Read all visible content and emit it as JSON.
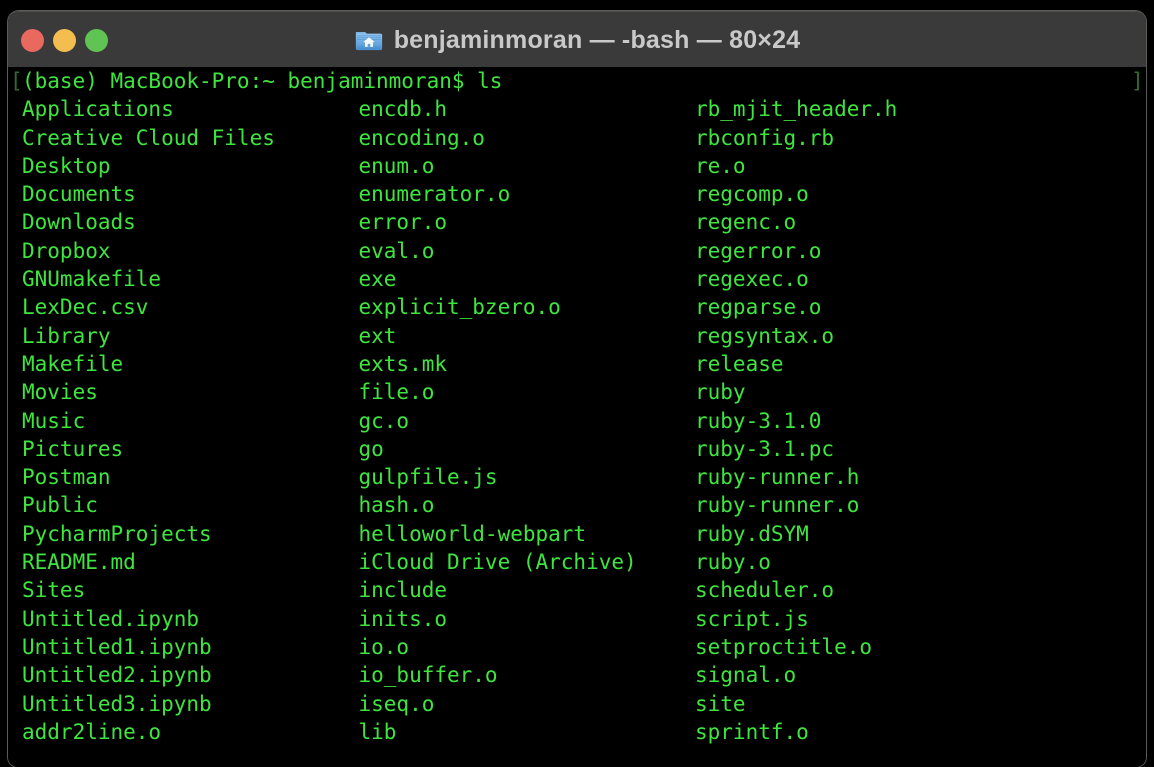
{
  "window": {
    "title": "benjaminmoran — -bash — 80×24",
    "icon": "home-folder-icon",
    "traffic_lights": {
      "close_color": "#e9695f",
      "minimize_color": "#f4bd4f",
      "maximize_color": "#5fc454"
    },
    "titlebar_color": "#3a3a3a"
  },
  "terminal": {
    "background_color": "#000000",
    "foreground_color": "#3fe53f",
    "dim_color": "#2f6a2f",
    "size": "80×24",
    "prompt_line": "(base) MacBook-Pro:~ benjaminmoran$ ls",
    "prompt_prefix_mark": "[",
    "prompt_suffix_mark": "]",
    "command": "ls",
    "columns": [
      [
        "Applications",
        "Creative Cloud Files",
        "Desktop",
        "Documents",
        "Downloads",
        "Dropbox",
        "GNUmakefile",
        "LexDec.csv",
        "Library",
        "Makefile",
        "Movies",
        "Music",
        "Pictures",
        "Postman",
        "Public",
        "PycharmProjects",
        "README.md",
        "Sites",
        "Untitled.ipynb",
        "Untitled1.ipynb",
        "Untitled2.ipynb",
        "Untitled3.ipynb",
        "addr2line.o"
      ],
      [
        "encdb.h",
        "encoding.o",
        "enum.o",
        "enumerator.o",
        "error.o",
        "eval.o",
        "exe",
        "explicit_bzero.o",
        "ext",
        "exts.mk",
        "file.o",
        "gc.o",
        "go",
        "gulpfile.js",
        "hash.o",
        "helloworld-webpart",
        "iCloud Drive (Archive)",
        "include",
        "inits.o",
        "io.o",
        "io_buffer.o",
        "iseq.o",
        "lib"
      ],
      [
        "rb_mjit_header.h",
        "rbconfig.rb",
        "re.o",
        "regcomp.o",
        "regenc.o",
        "regerror.o",
        "regexec.o",
        "regparse.o",
        "regsyntax.o",
        "release",
        "ruby",
        "ruby-3.1.0",
        "ruby-3.1.pc",
        "ruby-runner.h",
        "ruby-runner.o",
        "ruby.dSYM",
        "ruby.o",
        "scheduler.o",
        "script.js",
        "setproctitle.o",
        "signal.o",
        "site",
        "sprintf.o"
      ]
    ]
  }
}
